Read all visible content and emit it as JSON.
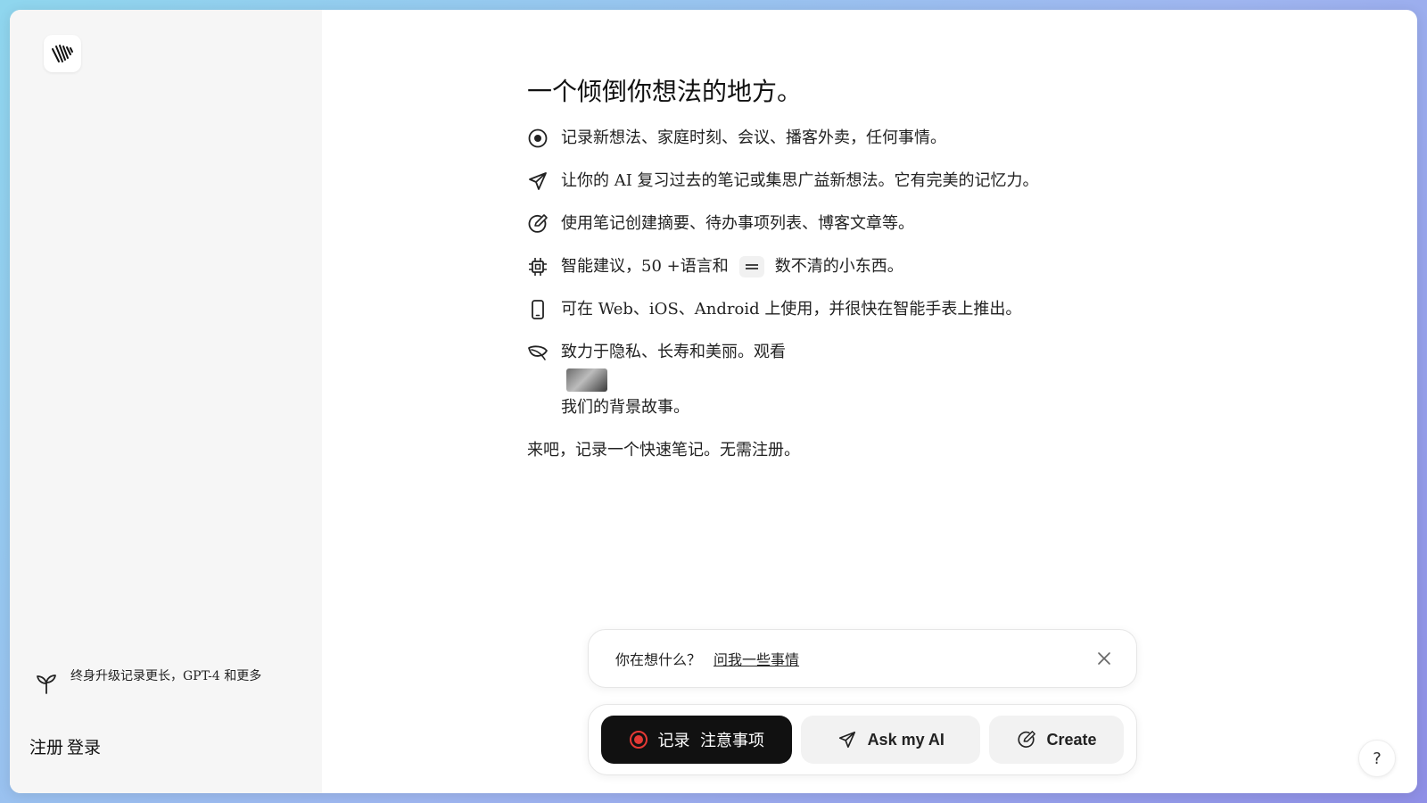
{
  "sidebar": {
    "logo_icon": "waveform-logo-icon",
    "upgrade": {
      "icon": "sprout-icon",
      "text": "终身升级记录更长，GPT-4 和更多"
    },
    "signup_label": "注册",
    "login_label": "登录"
  },
  "main": {
    "headline": "一个倾倒你想法的地方。",
    "features": [
      {
        "icon": "record-icon",
        "text": "记录新想法、家庭时刻、会议、播客外卖，任何事情。"
      },
      {
        "icon": "send-icon",
        "text": "让你的 AI 复习过去的笔记或集思广益新想法。它有完美的记忆力。"
      },
      {
        "icon": "edit-circle-icon",
        "text": "使用笔记创建摘要、待办事项列表、博客文章等。"
      },
      {
        "icon": "chip-icon",
        "text_before": "智能建议，50 +语言和",
        "text_after": "数不清的小东西。"
      },
      {
        "icon": "phone-icon",
        "text": "可在 Web、iOS、Android 上使用，并很快在智能手表上推出。"
      },
      {
        "icon": "leaf-icon",
        "text_before": "致力于隐私、长寿和美丽。观看",
        "text_after": "我们的背景故事。"
      }
    ],
    "cta": "来吧，记录一个快速笔记。无需注册。"
  },
  "prompt": {
    "question": "你在想什么？",
    "ask_link": "问我一些事情"
  },
  "actions": {
    "record_label": "记录  注意事项",
    "ask_label": "Ask my AI",
    "create_label": "Create"
  },
  "help_label": "?",
  "colors": {
    "accent_red": "#e53935",
    "primary_button": "#111111"
  }
}
